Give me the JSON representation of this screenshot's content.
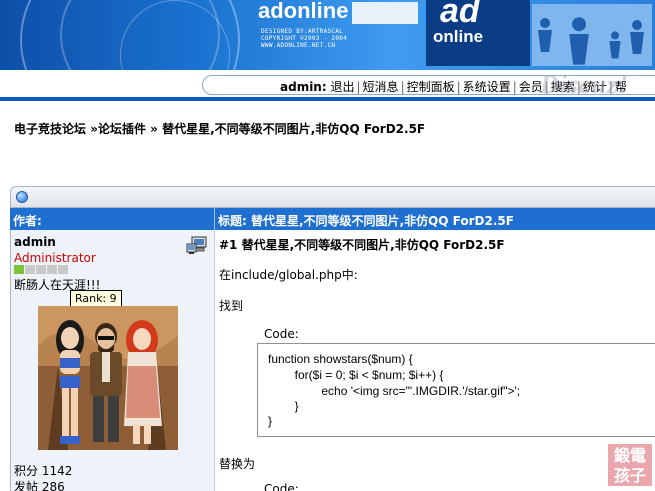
{
  "banner": {
    "brand": "adonline",
    "credits": [
      "DESIGNED BY:ARTRASCAL",
      "COPYRIGHT ©2003 - 2004",
      "WWW.ADONLINE.NET.CN"
    ],
    "logo_top": "ad",
    "logo_bottom": "online"
  },
  "menu": {
    "user": "admin:",
    "items": [
      "退出",
      "短消息",
      "控制面板",
      "系统设置",
      "会员",
      "搜索",
      "统计",
      "帮"
    ],
    "watermark": "Discuz!"
  },
  "breadcrumb": {
    "forum": "电子竞技论坛",
    "section": "论坛插件",
    "thread": "替代星星,不同等级不同图片,非仿QQ ForD2.5F",
    "sep": "»"
  },
  "table": {
    "author_header": "作者:",
    "title_header": "标题: 替代星星,不同等级不同图片,非仿QQ ForD2.5F"
  },
  "author": {
    "name": "admin",
    "group": "Administrator",
    "bio": "断肠人在天涯!!!",
    "rank_tooltip": "Rank: 9",
    "stars_total": 5,
    "stars_on": 1,
    "points": "积分 1142",
    "posts": "发帖 286"
  },
  "post": {
    "title": "#1  替代星星,不同等级不同图片,非仿QQ ForD2.5F",
    "line1": "在include/global.php中:",
    "line2": "找到",
    "code_label": "Code:",
    "code": [
      "function showstars($num) {",
      "        for($i = 0; $i < $num; $i++) {",
      "                echo '<img src=\"'.IMGDIR.'/star.gif\">';",
      "        }",
      "}"
    ],
    "line3": "替换为",
    "code_label2": "Code:"
  },
  "corner_watermark": [
    "鍛電",
    "孩子"
  ]
}
